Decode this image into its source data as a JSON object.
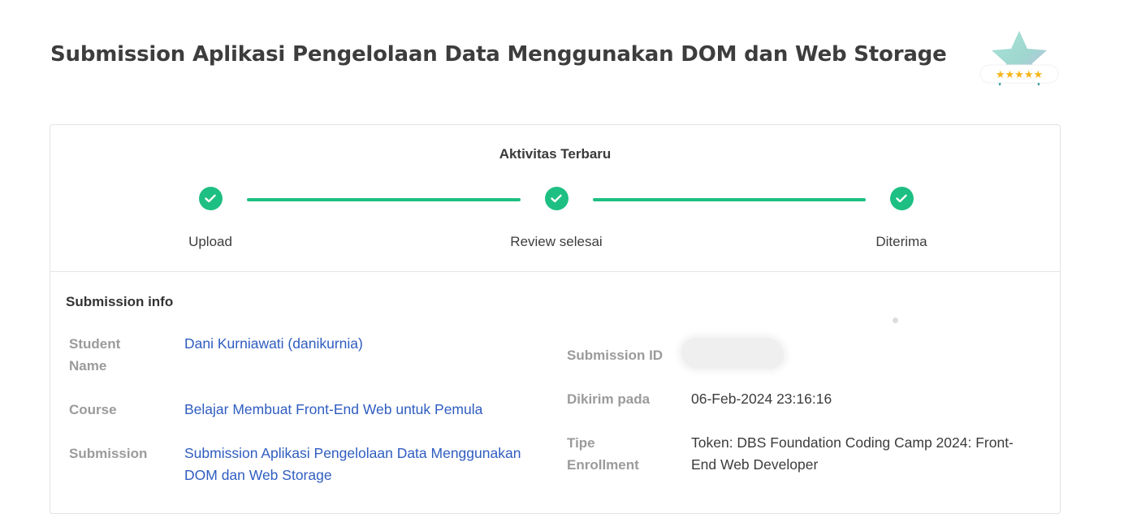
{
  "page": {
    "title": "Submission Aplikasi Pengelolaan Data Menggunakan DOM dan Web Storage"
  },
  "badge": {
    "icon": "star-rating-badge-icon",
    "rating_stars": 5,
    "colors": {
      "star": "#8fd3c6",
      "ribbon": "#1aa3a0",
      "rating": "#f5b418"
    }
  },
  "activity": {
    "title": "Aktivitas Terbaru",
    "steps": [
      {
        "label": "Upload",
        "status": "done",
        "icon": "check-icon"
      },
      {
        "label": "Review selesai",
        "status": "done",
        "icon": "check-icon"
      },
      {
        "label": "Diterima",
        "status": "done",
        "icon": "check-icon"
      }
    ],
    "accent_color": "#1ebf82"
  },
  "submission_info": {
    "title": "Submission info",
    "student_name": {
      "label": "Student Name",
      "value": "Dani Kurniawati (danikurnia)"
    },
    "course": {
      "label": "Course",
      "value": "Belajar Membuat Front-End Web untuk Pemula"
    },
    "submission": {
      "label": "Submission",
      "value": "Submission Aplikasi Pengelolaan Data Menggunakan DOM dan Web Storage"
    },
    "submission_id": {
      "label": "Submission ID",
      "value": ""
    },
    "sent_at": {
      "label": "Dikirim pada",
      "value": "06-Feb-2024 23:16:16"
    },
    "enrollment_type": {
      "label": "Tipe Enrollment",
      "value": "Token: DBS Foundation Coding Camp 2024: Front-End Web Developer"
    },
    "link_color": "#2f5dc0"
  }
}
